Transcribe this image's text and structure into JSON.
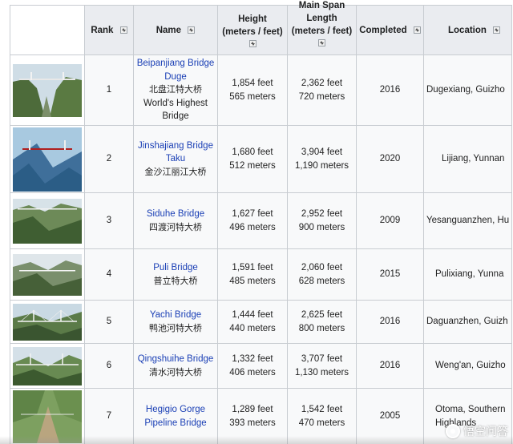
{
  "table": {
    "headers": {
      "rank": "Rank",
      "name": "Name",
      "height_line1": "Height",
      "height_line2": "(meters / feet)",
      "span_line1": "Main Span",
      "span_line2": "Length",
      "span_line3": "(meters / feet)",
      "completed": "Completed",
      "location": "Location"
    },
    "rows": [
      {
        "rank": "1",
        "name_en": "Beipanjiang Bridge Duge",
        "name_zh": "北盘江特大桥",
        "note": "World's Highest Bridge",
        "height_ft": "1,854 feet",
        "height_m": "565 meters",
        "span_ft": "2,362 feet",
        "span_m": "720 meters",
        "completed": "2016",
        "location": "Dugexiang, Guizho",
        "thumb": "bridge-photo"
      },
      {
        "rank": "2",
        "name_en": "Jinshajiang Bridge Taku",
        "name_zh": "金沙江丽江大桥",
        "height_ft": "1,680 feet",
        "height_m": "512 meters",
        "span_ft": "3,904 feet",
        "span_m": "1,190 meters",
        "completed": "2020",
        "location": "Lijiang, Yunnan",
        "thumb": "bridge-photo"
      },
      {
        "rank": "3",
        "name_en": "Siduhe Bridge",
        "name_zh": "四渡河特大桥",
        "height_ft": "1,627 feet",
        "height_m": "496 meters",
        "span_ft": "2,952 feet",
        "span_m": "900 meters",
        "completed": "2009",
        "location": "Yesanguanzhen, Hu",
        "thumb": "bridge-photo"
      },
      {
        "rank": "4",
        "name_en": "Puli Bridge",
        "name_zh": "普立特大桥",
        "height_ft": "1,591 feet",
        "height_m": "485 meters",
        "span_ft": "2,060 feet",
        "span_m": "628 meters",
        "completed": "2015",
        "location": "Pulixiang, Yunna",
        "thumb": "bridge-photo"
      },
      {
        "rank": "5",
        "name_en": "Yachi Bridge",
        "name_zh": "鸭池河特大桥",
        "height_ft": "1,444 feet",
        "height_m": "440 meters",
        "span_ft": "2,625 feet",
        "span_m": "800 meters",
        "completed": "2016",
        "location": "Daguanzhen, Guizh",
        "thumb": "bridge-photo"
      },
      {
        "rank": "6",
        "name_en": "Qingshuihe Bridge",
        "name_zh": "清水河特大桥",
        "height_ft": "1,332 feet",
        "height_m": "406 meters",
        "span_ft": "3,707 feet",
        "span_m": "1,130 meters",
        "completed": "2016",
        "location": "Weng'an, Guizho",
        "thumb": "bridge-photo"
      },
      {
        "rank": "7",
        "name_en": "Hegigio Gorge Pipeline Bridge",
        "name_zh": "",
        "height_ft": "1,289 feet",
        "height_m": "393 meters",
        "span_ft": "1,542 feet",
        "span_m": "470 meters",
        "completed": "2005",
        "location": "Otoma, Southern Highlands",
        "thumb": "bridge-photo"
      }
    ]
  },
  "watermark": {
    "text": "悟空问答",
    "icon": "logo-icon"
  }
}
